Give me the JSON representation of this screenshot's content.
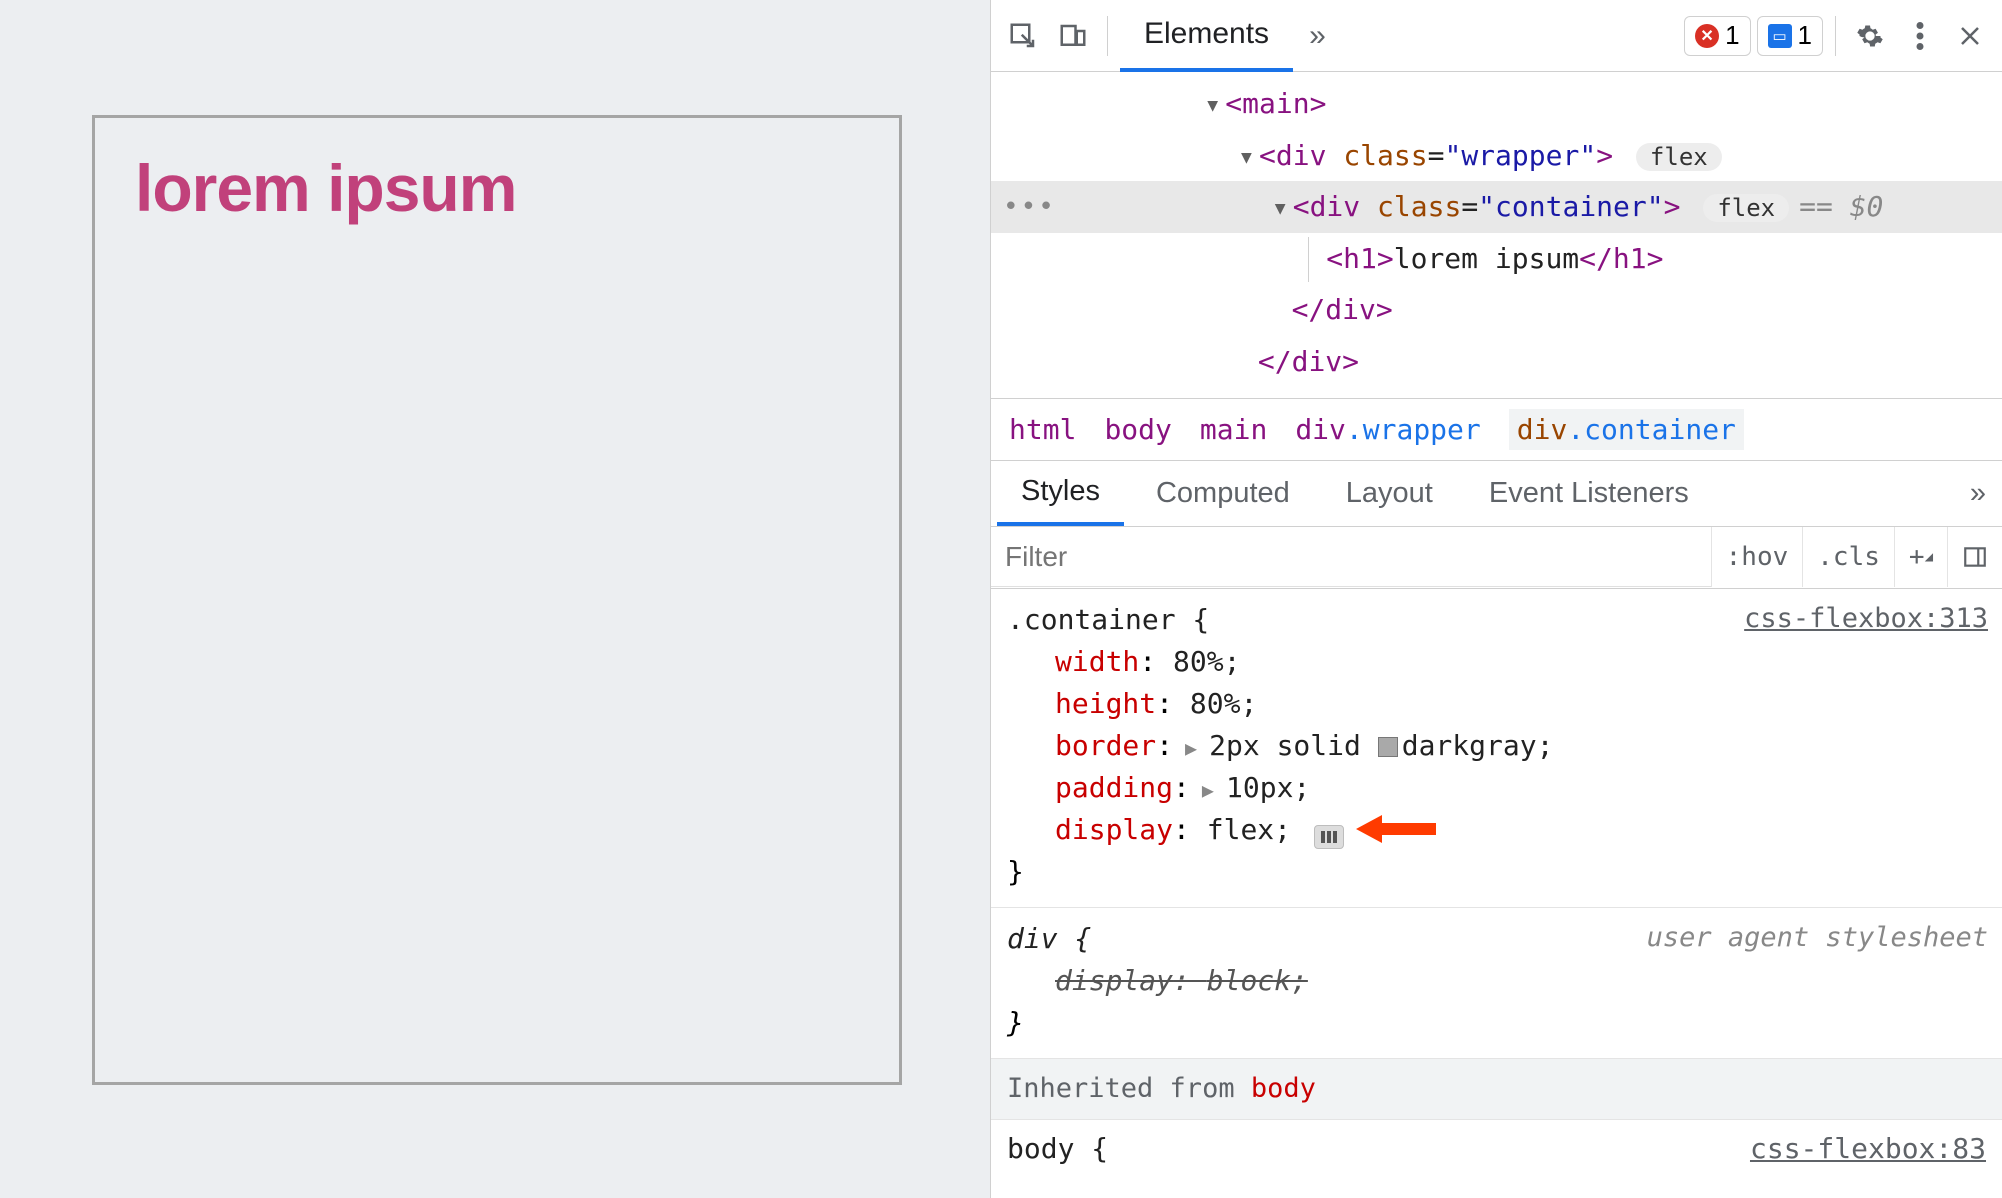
{
  "page": {
    "heading": "lorem ipsum"
  },
  "toolbar": {
    "active_tab": "Elements",
    "more_label": "»",
    "error_count": "1",
    "message_count": "1"
  },
  "dom": {
    "l1": {
      "open": "<",
      "tag": "main",
      "close": ">"
    },
    "l2": {
      "open": "<",
      "tag": "div",
      "attr_name": "class",
      "eq": "=",
      "q": "\"",
      "attr_val": "wrapper",
      "close": ">",
      "pill": "flex"
    },
    "l3": {
      "open": "<",
      "tag": "div",
      "attr_name": "class",
      "eq": "=",
      "q": "\"",
      "attr_val": "container",
      "close": ">",
      "pill": "flex",
      "suffix": "== $0"
    },
    "l4": {
      "open": "<",
      "tag": "h1",
      "close": ">",
      "text": "lorem ipsum",
      "copen": "</",
      "cclose": ">"
    },
    "l5": {
      "copen": "</",
      "tag": "div",
      "cclose": ">"
    },
    "l6": {
      "copen": "</",
      "tag": "div",
      "cclose": ">"
    }
  },
  "breadcrumbs": {
    "c1": "html",
    "c2": "body",
    "c3": "main",
    "c4_name": "div",
    "c4_cls": ".wrapper",
    "c5_name": "div",
    "c5_cls": ".container"
  },
  "secondary_tabs": {
    "styles": "Styles",
    "computed": "Computed",
    "layout": "Layout",
    "listeners": "Event Listeners",
    "more": "»"
  },
  "filter": {
    "placeholder": "Filter",
    "hov": ":hov",
    "cls": ".cls",
    "plus": "+"
  },
  "rule1": {
    "selector": ".container {",
    "src": "css-flexbox:313",
    "d1_p": "width",
    "d1_v": "80%;",
    "d2_p": "height",
    "d2_v": "80%;",
    "d3_p": "border",
    "d3_v_a": "2px solid ",
    "d3_v_b": "darkgray;",
    "d4_p": "padding",
    "d4_v": "10px;",
    "d5_p": "display",
    "d5_v": "flex;",
    "close": "}"
  },
  "rule2": {
    "selector": "div {",
    "src": "user agent stylesheet",
    "d1_p": "display",
    "d1_v": "block;",
    "close": "}"
  },
  "inherit": {
    "label": "Inherited from ",
    "from": "body"
  },
  "rule3": {
    "selector": "body {",
    "src": "css-flexbox:83"
  }
}
